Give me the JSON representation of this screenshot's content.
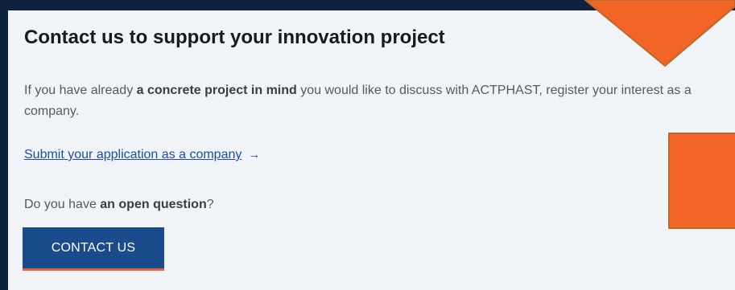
{
  "section": {
    "title": "Contact us to support your innovation project",
    "intro_prefix": "If you have already ",
    "intro_bold": "a concrete project in mind",
    "intro_suffix": " you would like to discuss with ACTPHAST, register your interest as a company.",
    "link_label": "Submit your application as a company",
    "link_arrow": "→",
    "question_prefix": "Do you have ",
    "question_bold": "an open question",
    "question_suffix": "?",
    "button_label": "CONTACT US"
  },
  "icons": {
    "link_arrow": "arrow-right-icon"
  },
  "colors": {
    "background": "#0f2340",
    "card": "#f0f3f8",
    "accent_orange": "#f26526",
    "button_blue": "#1a4b8c",
    "link_blue": "#1f4f9a"
  }
}
